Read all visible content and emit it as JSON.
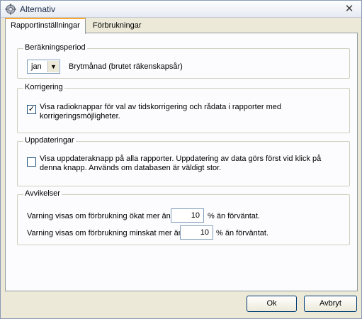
{
  "window": {
    "title": "Alternativ",
    "close_icon": "close-icon"
  },
  "tabs": [
    {
      "label": "Rapportinställningar",
      "active": true
    },
    {
      "label": "Förbrukningar",
      "active": false
    }
  ],
  "period": {
    "legend": "Beräkningsperiod",
    "month_value": "jan",
    "label": "Brytmånad (brutet räkenskapsår)"
  },
  "correction": {
    "legend": "Korrigering",
    "checked": true,
    "text": "Visa radioknappar för val av tidskorrigering och rådata i rapporter med korrigeringsmöjligheter."
  },
  "updates": {
    "legend": "Uppdateringar",
    "checked": false,
    "text": "Visa uppdateraknapp på alla rapporter. Uppdatering av data görs först vid klick på denna knapp. Används om databasen är väldigt stor."
  },
  "deviations": {
    "legend": "Avvikelser",
    "increase_label": "Varning visas om förbrukning ökat mer än",
    "increase_value": "10",
    "increase_unit": "% än förväntat.",
    "decrease_label": "Varning visas om förbrukning minskat mer än",
    "decrease_value": "10",
    "decrease_unit": "% än förväntat."
  },
  "buttons": {
    "ok": "Ok",
    "cancel": "Avbryt"
  }
}
